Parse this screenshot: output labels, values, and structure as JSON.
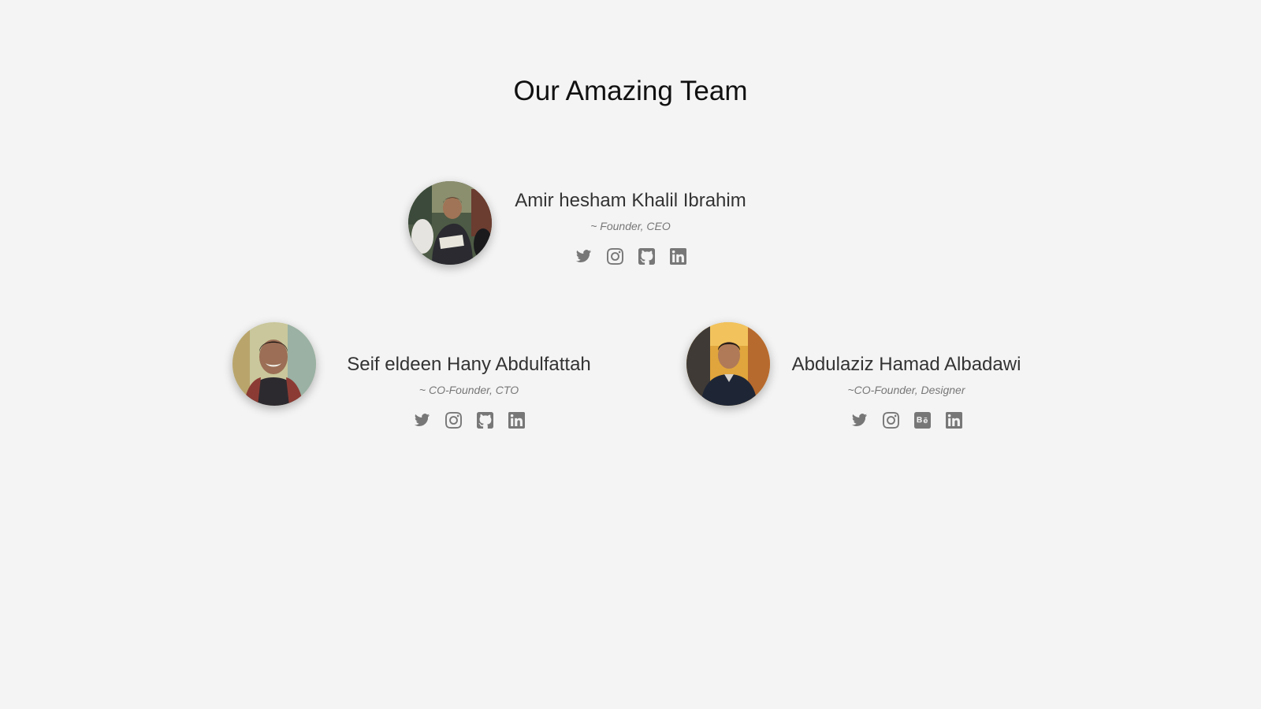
{
  "section": {
    "title": "Our Amazing Team"
  },
  "colors": {
    "background": "#f4f4f4",
    "name_text": "#333333",
    "role_text": "#777777",
    "icon": "#777777"
  },
  "team": [
    {
      "name": "Amir hesham Khalil Ibrahim",
      "role": "~ Founder, CEO",
      "socials": [
        "twitter-icon",
        "instagram-icon",
        "github-icon",
        "linkedin-icon"
      ]
    },
    {
      "name": "Seif eldeen Hany Abdulfattah",
      "role": "~ CO-Founder, CTO",
      "socials": [
        "twitter-icon",
        "instagram-icon",
        "github-icon",
        "linkedin-icon"
      ]
    },
    {
      "name": "Abdulaziz Hamad Albadawi",
      "role": "~CO-Founder, Designer",
      "socials": [
        "twitter-icon",
        "instagram-icon",
        "behance-icon",
        "linkedin-icon"
      ]
    }
  ]
}
